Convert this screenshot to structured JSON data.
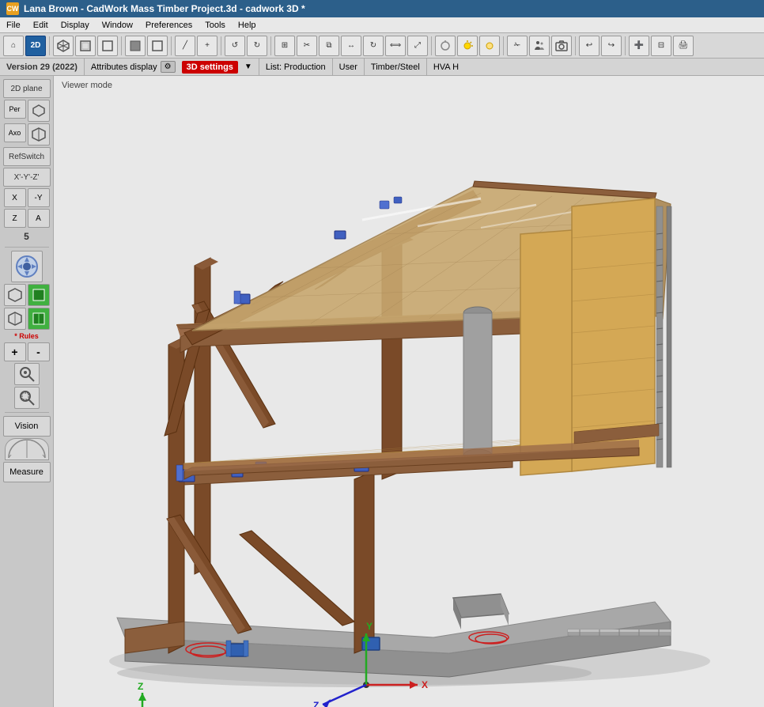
{
  "titleBar": {
    "icon": "CW",
    "title": "Lana Brown - CadWork Mass Timber Project.3d - cadwork 3D *"
  },
  "menuBar": {
    "items": [
      "File",
      "Edit",
      "Display",
      "Window",
      "Preferences",
      "Tools",
      "Help"
    ]
  },
  "toolbar": {
    "buttons": [
      {
        "name": "home",
        "label": "⌂"
      },
      {
        "name": "2d-mode",
        "label": "2D"
      },
      {
        "name": "cube-iso",
        "label": "⬡"
      },
      {
        "name": "cube-front",
        "label": "▣"
      },
      {
        "name": "cube-top",
        "label": "⬜"
      },
      {
        "name": "solid",
        "label": "▪"
      },
      {
        "name": "wireframe",
        "label": "□"
      },
      {
        "name": "draw-line",
        "label": "╱"
      },
      {
        "name": "add-point",
        "label": "+"
      },
      {
        "name": "undo",
        "label": "↺"
      },
      {
        "name": "redo",
        "label": "↻"
      },
      {
        "name": "zoom-fit",
        "label": "⊞"
      },
      {
        "name": "cut",
        "label": "✂"
      },
      {
        "name": "copy",
        "label": "⧉"
      },
      {
        "name": "move",
        "label": "↔"
      },
      {
        "name": "rotate",
        "label": "↻"
      },
      {
        "name": "mirror",
        "label": "⟺"
      },
      {
        "name": "scale",
        "label": "⤢"
      },
      {
        "name": "light-off",
        "label": "☽"
      },
      {
        "name": "light-on",
        "label": "☀"
      },
      {
        "name": "light-env",
        "label": "💡"
      },
      {
        "name": "sep1",
        "label": "|"
      },
      {
        "name": "cut-tool",
        "label": "✁"
      },
      {
        "name": "people",
        "label": "👥"
      },
      {
        "name": "camera",
        "label": "📷"
      },
      {
        "name": "sep2",
        "label": "|"
      },
      {
        "name": "arrow-undo",
        "label": "↩"
      },
      {
        "name": "arrow-redo",
        "label": "↪"
      },
      {
        "name": "sep3",
        "label": "|"
      },
      {
        "name": "plus-square",
        "label": "➕"
      },
      {
        "name": "minus-square",
        "label": "⊟"
      },
      {
        "name": "print",
        "label": "🖨"
      }
    ]
  },
  "infoBar": {
    "version": "Version 29 (2022)",
    "attrDisplay": "Attributes display",
    "settingsGear": "⚙",
    "3dSettings": "3D settings",
    "listProduction": "List: Production",
    "user": "User",
    "timberSteel": "Timber/Steel",
    "hva": "HVA H"
  },
  "sidebar": {
    "plane2d": "2D plane",
    "per": "Per",
    "axo": "Axo",
    "refswitch": "RefSwitch",
    "xYZ": "X'-Y'-Z'",
    "x": "X",
    "negY": "-Y",
    "z": "Z",
    "a": "A",
    "number5": "5",
    "rulesRed": "* Rules",
    "zoomPlus": "+",
    "zoomMinus": "-",
    "vision": "Vision",
    "measure": "Measure"
  },
  "viewer": {
    "modeLabel": "Viewer mode"
  },
  "colors": {
    "background": "#e0e0e0",
    "timber": "#8B5E3C",
    "timberLight": "#C8913A",
    "panelWood": "#D4A855",
    "concrete": "#8C8C8C",
    "metalBlue": "#4060A0",
    "accentRed": "#CC2020",
    "connectorBlue": "#3070C0",
    "axisX": "#CC2020",
    "axisY": "#22AA22",
    "axisZ": "#2222CC",
    "floorDark": "#707070"
  }
}
